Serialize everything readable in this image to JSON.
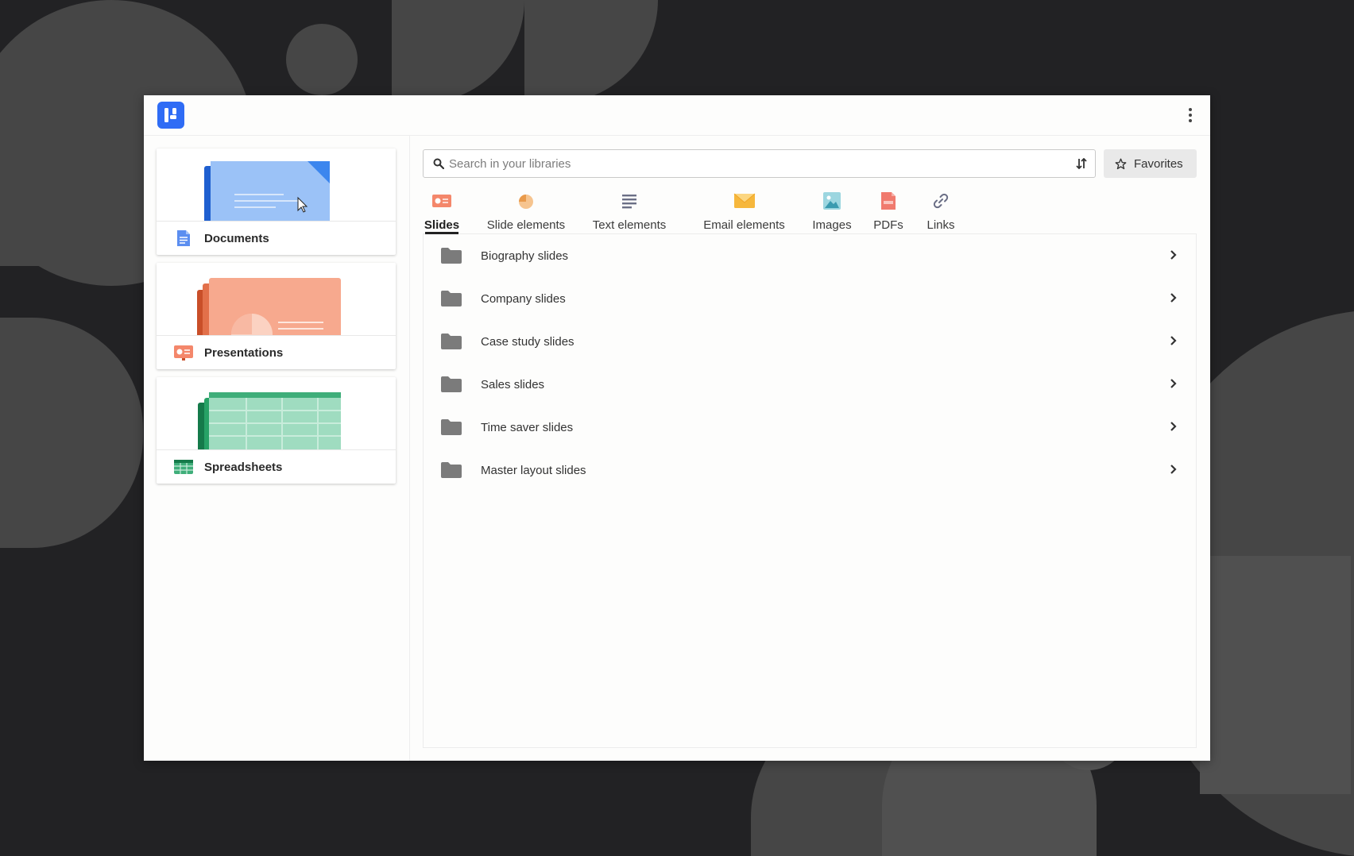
{
  "header": {
    "logo_icon": "brand-logo-icon",
    "menu_icon": "more-vertical-icon"
  },
  "sidebar": {
    "cards": [
      {
        "label": "Documents",
        "icon": "document-icon",
        "color": "#5b8ef0"
      },
      {
        "label": "Presentations",
        "icon": "presentation-icon",
        "color": "#f4876b"
      },
      {
        "label": "Spreadsheets",
        "icon": "spreadsheet-icon",
        "color": "#3fae7a"
      }
    ]
  },
  "search": {
    "placeholder": "Search in your libraries",
    "value": ""
  },
  "favorites": {
    "label": "Favorites"
  },
  "tabs": [
    {
      "label": "Slides",
      "icon": "slides-icon",
      "active": true
    },
    {
      "label": "Slide elements",
      "icon": "pie-chart-icon"
    },
    {
      "label": "Text elements",
      "icon": "text-lines-icon"
    },
    {
      "label": "Email elements",
      "icon": "envelope-icon"
    },
    {
      "label": "Images",
      "icon": "image-icon"
    },
    {
      "label": "PDFs",
      "icon": "pdf-icon"
    },
    {
      "label": "Links",
      "icon": "link-icon"
    }
  ],
  "folders": [
    {
      "label": "Biography slides"
    },
    {
      "label": "Company slides"
    },
    {
      "label": "Case study slides"
    },
    {
      "label": "Sales slides"
    },
    {
      "label": "Time saver slides"
    },
    {
      "label": "Master layout slides"
    }
  ],
  "colors": {
    "accent": "#2f6cf5",
    "background": "#222224",
    "folder": "#7b7b7b"
  }
}
